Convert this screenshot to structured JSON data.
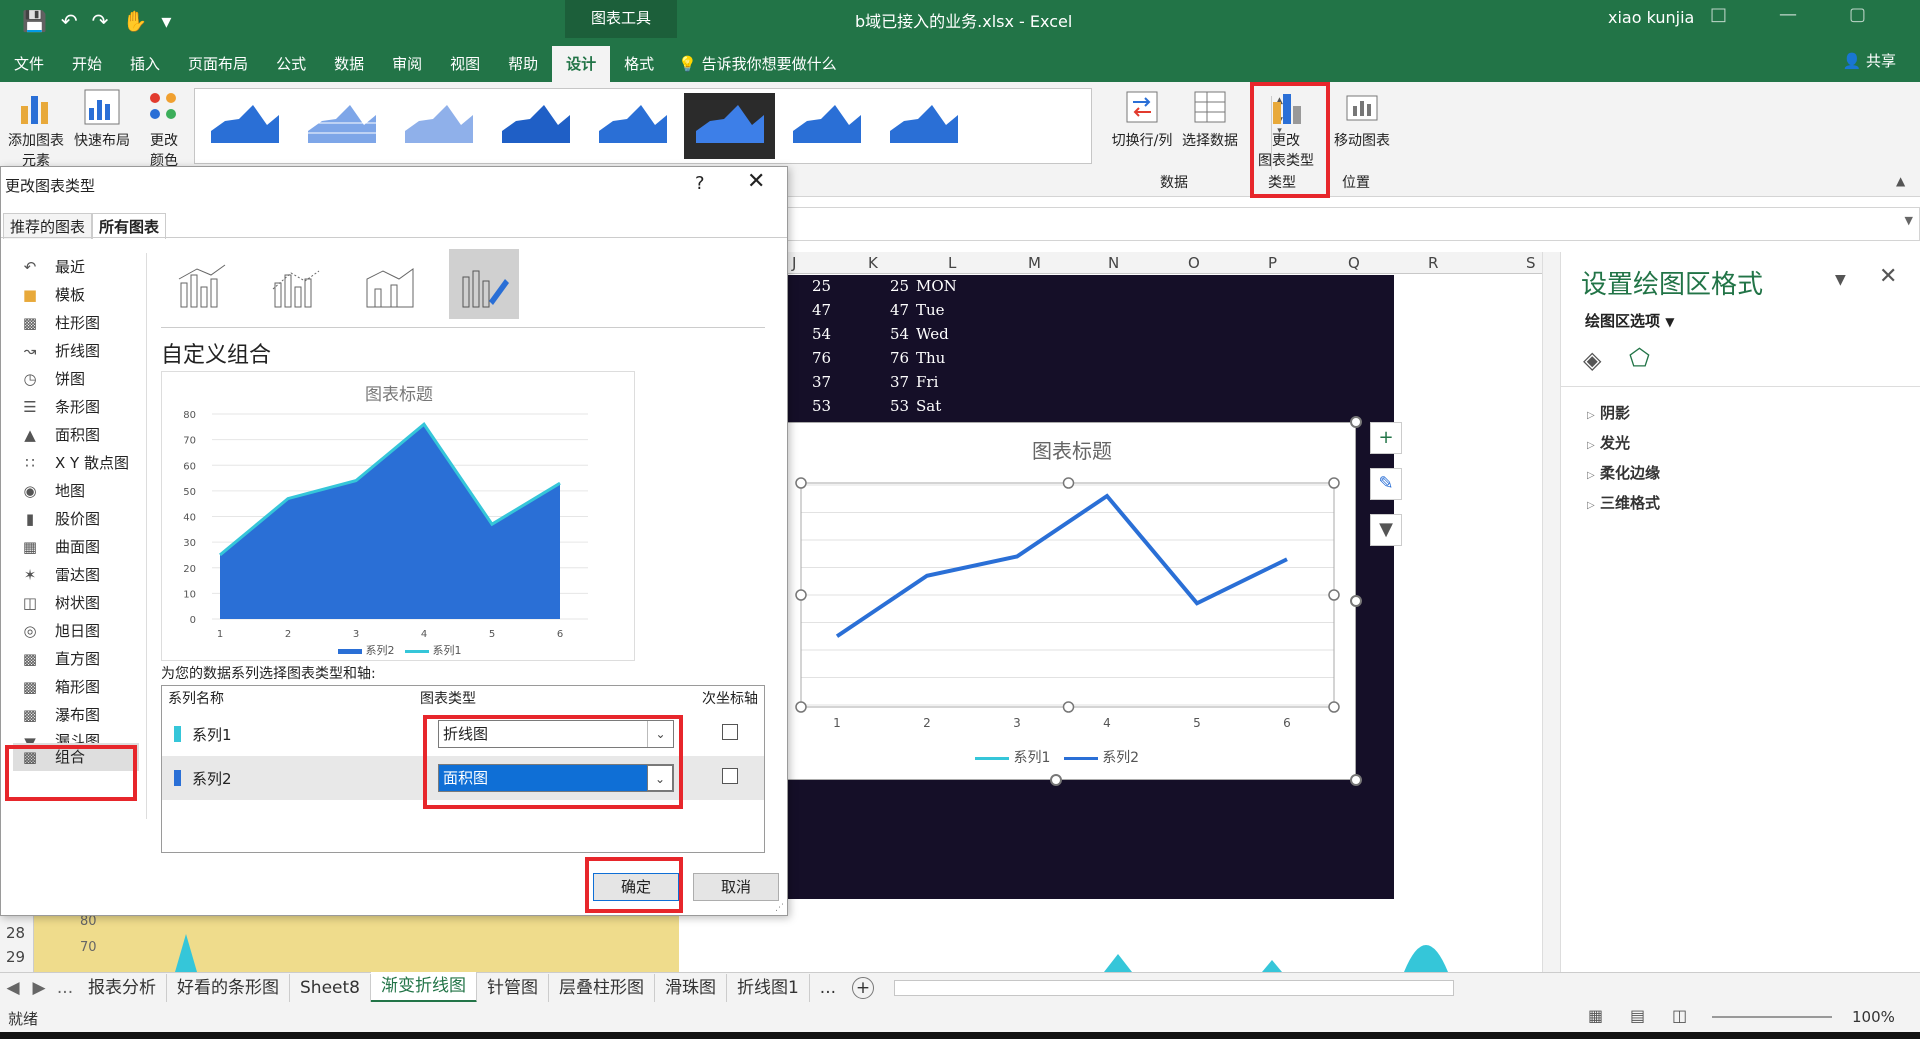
{
  "window": {
    "title": "b域已接入的业务.xlsx - Excel",
    "context_tab_group": "图表工具",
    "user": "xiao kunjia",
    "share": "共享"
  },
  "tabs": [
    "文件",
    "开始",
    "插入",
    "页面布局",
    "公式",
    "数据",
    "审阅",
    "视图",
    "帮助",
    "设计",
    "格式"
  ],
  "active_tab": "设计",
  "tell_me": "告诉我你想要做什么",
  "ribbon": {
    "add_element_1": "添加图表",
    "add_element_2": "元素",
    "quick_layout": "快速布局",
    "change_color_1": "更改",
    "change_color_2": "颜色",
    "switch_row_col": "切换行/列",
    "select_data": "选择数据",
    "group_data": "数据",
    "change_type_1": "更改",
    "change_type_2": "图表类型",
    "group_type": "类型",
    "move_chart": "移动图表",
    "group_location": "位置"
  },
  "sheet": {
    "columns": [
      "J",
      "K",
      "L",
      "M",
      "N",
      "O",
      "P",
      "Q",
      "R",
      "S"
    ],
    "row_numbers": [
      "28",
      "29"
    ],
    "strip_axis": [
      "80",
      "70"
    ],
    "rows": [
      {
        "j": "25",
        "k": "25",
        "l": "MON"
      },
      {
        "j": "47",
        "k": "47",
        "l": "Tue"
      },
      {
        "j": "54",
        "k": "54",
        "l": "Wed"
      },
      {
        "j": "76",
        "k": "76",
        "l": "Thu"
      },
      {
        "j": "37",
        "k": "37",
        "l": "Fri"
      },
      {
        "j": "53",
        "k": "53",
        "l": "Sat"
      }
    ]
  },
  "sheet_chart": {
    "title": "图表标题",
    "x": [
      "1",
      "2",
      "3",
      "4",
      "5",
      "6"
    ],
    "legend": [
      "系列1",
      "系列2"
    ],
    "series_line": [
      25,
      47,
      54,
      76,
      37,
      53
    ],
    "color": "#2a6fd6"
  },
  "format_pane": {
    "title": "设置绘图区格式",
    "options": "绘图区选项",
    "items": [
      "阴影",
      "发光",
      "柔化边缘",
      "三维格式"
    ]
  },
  "dialog": {
    "title": "更改图表类型",
    "help": "?",
    "tabs": [
      "推荐的图表",
      "所有图表"
    ],
    "active_tab": "所有图表",
    "categories": [
      "最近",
      "模板",
      "柱形图",
      "折线图",
      "饼图",
      "条形图",
      "面积图",
      "X Y 散点图",
      "地图",
      "股价图",
      "曲面图",
      "雷达图",
      "树状图",
      "旭日图",
      "直方图",
      "箱形图",
      "瀑布图",
      "漏斗图",
      "组合"
    ],
    "active_category": "组合",
    "combo_title": "自定义组合",
    "preview": {
      "title": "图表标题",
      "y_ticks": [
        "80",
        "70",
        "60",
        "50",
        "40",
        "30",
        "20",
        "10",
        "0"
      ],
      "x": [
        "1",
        "2",
        "3",
        "4",
        "5",
        "6"
      ],
      "legend": [
        "系列2",
        "系列1"
      ]
    },
    "series_prompt": "为您的数据系列选择图表类型和轴:",
    "table_headers": {
      "name": "系列名称",
      "type": "图表类型",
      "secondary": "次坐标轴"
    },
    "series": [
      {
        "name": "系列1",
        "type": "折线图",
        "color": "#35c6d9"
      },
      {
        "name": "系列2",
        "type": "面积图",
        "color": "#2a6fd6"
      }
    ],
    "ok": "确定",
    "cancel": "取消"
  },
  "chart_data": {
    "type": "area",
    "title": "图表标题",
    "x": [
      1,
      2,
      3,
      4,
      5,
      6
    ],
    "series": [
      {
        "name": "系列2",
        "values": [
          25,
          47,
          54,
          76,
          37,
          53
        ]
      },
      {
        "name": "系列1",
        "values": [
          25,
          47,
          54,
          76,
          37,
          53
        ]
      }
    ],
    "ylim": [
      0,
      80
    ],
    "yticks": [
      0,
      10,
      20,
      30,
      40,
      50,
      60,
      70,
      80
    ]
  },
  "sheet_tabs": [
    "报表分析",
    "好看的条形图",
    "Sheet8",
    "渐变折线图",
    "针管图",
    "层叠柱形图",
    "滑珠图",
    "折线图1",
    "..."
  ],
  "active_sheet": "渐变折线图",
  "status": {
    "ready": "就绪",
    "zoom": "100%"
  }
}
